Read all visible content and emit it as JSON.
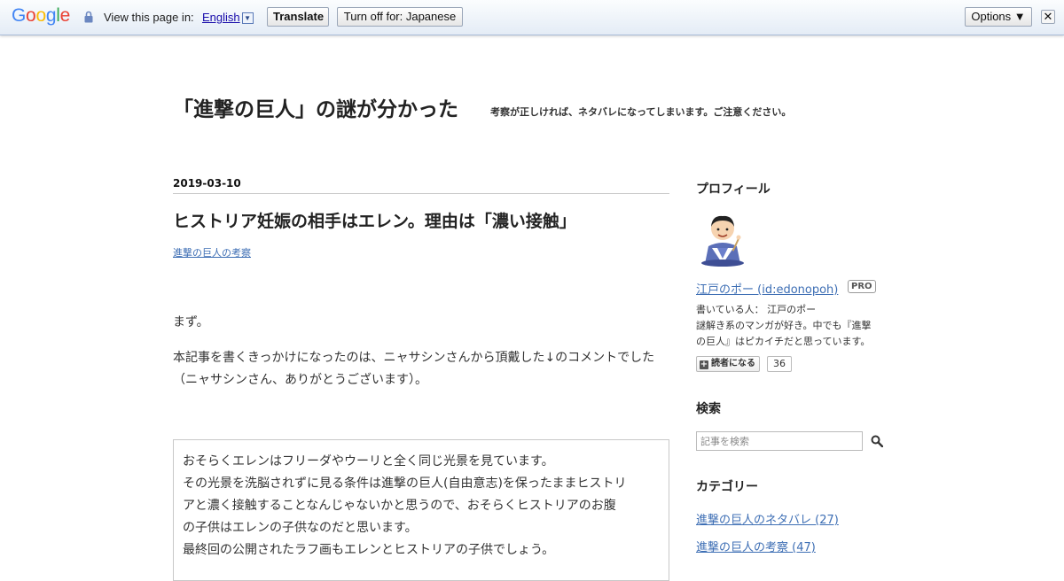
{
  "translate_bar": {
    "logo_letters": [
      "G",
      "o",
      "o",
      "g",
      "l",
      "e"
    ],
    "view_label": "View this page in:",
    "language": "English",
    "translate_label": "Translate",
    "turn_off_label": "Turn off for: Japanese",
    "options_label": "Options ▼",
    "close_label": "✕"
  },
  "blog": {
    "title": "「進撃の巨人」の謎が分かった",
    "description": "考察が正しければ、ネタバレになってしまいます。ご注意ください。"
  },
  "entry": {
    "date": "2019-03-10",
    "title": "ヒストリア妊娠の相手はエレン。理由は「濃い接触」",
    "category": "進撃の巨人の考察",
    "paragraphs": [
      "まず。",
      "本記事を書くきっかけになったのは、ニャサシンさんから頂戴した↓のコメントでした（ニャサシンさん、ありがとうございます）。"
    ],
    "quote_lines": [
      "おそらくエレンはフリーダやウーリと全く同じ光景を見ています。",
      "その光景を洗脳されずに見る条件は進撃の巨人(自由意志)を保ったままヒストリ",
      "アと濃く接触することなんじゃないかと思うので、おそらくヒストリアのお腹",
      "の子供はエレンの子供なのだと思います。",
      "最終回の公開されたラフ画もエレンとヒストリアの子供でしょう。"
    ]
  },
  "sidebar": {
    "profile_heading": "プロフィール",
    "profile_name": "江戸のポー (id:edonopoh)",
    "pro_badge": "PRO",
    "profile_lines": [
      "書いている人： 江戸のポー",
      "謎解き系のマンガが好き。中でも『進撃",
      "の巨人』はピカイチだと思っています。"
    ],
    "subscribe_label": "読者になる",
    "subscriber_count": "36",
    "search_heading": "検索",
    "search_placeholder": "記事を検索",
    "category_heading": "カテゴリー",
    "categories": [
      "進撃の巨人のネタバレ (27)",
      "進撃の巨人の考察 (47)"
    ]
  },
  "colors": {
    "link": "#3d6eb4",
    "google_blue": "#4285f4",
    "google_red": "#ea4335",
    "google_yellow": "#fbbc05",
    "google_green": "#34a853"
  },
  "icons": [
    "lock-icon",
    "search-icon",
    "plus-icon",
    "close-icon",
    "avatar"
  ]
}
